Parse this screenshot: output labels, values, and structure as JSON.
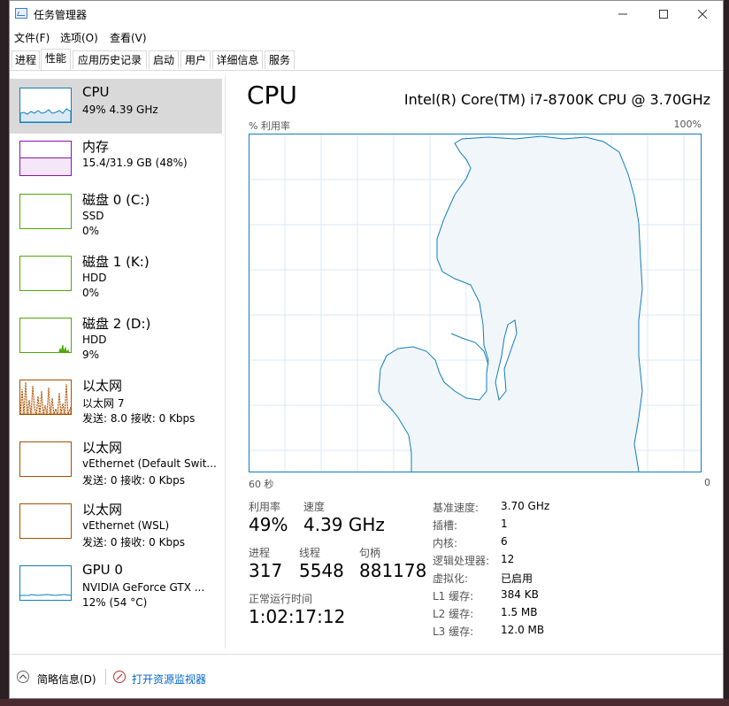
{
  "window": {
    "title": "任务管理器"
  },
  "menu": {
    "file": "文件(F)",
    "options": "选项(O)",
    "view": "查看(V)"
  },
  "tabs": [
    "进程",
    "性能",
    "应用历史记录",
    "启动",
    "用户",
    "详细信息",
    "服务"
  ],
  "sidebar": {
    "items": [
      {
        "title": "CPU",
        "line1": "49% 4.39 GHz",
        "line2": ""
      },
      {
        "title": "内存",
        "line1": "15.4/31.9 GB (48%)",
        "line2": ""
      },
      {
        "title": "磁盘 0 (C:)",
        "line1": "SSD",
        "line2": "0%"
      },
      {
        "title": "磁盘 1 (K:)",
        "line1": "HDD",
        "line2": "0%"
      },
      {
        "title": "磁盘 2 (D:)",
        "line1": "HDD",
        "line2": "9%"
      },
      {
        "title": "以太网",
        "line1": "以太网 7",
        "line2": "发送: 8.0 接收: 0 Kbps"
      },
      {
        "title": "以太网",
        "line1": "vEthernet (Default Swit...",
        "line2": "发送: 0 接收: 0 Kbps"
      },
      {
        "title": "以太网",
        "line1": "vEthernet (WSL)",
        "line2": "发送: 0 接收: 0 Kbps"
      },
      {
        "title": "GPU 0",
        "line1": "NVIDIA GeForce GTX ...",
        "line2": "12% (54 °C)"
      }
    ]
  },
  "main": {
    "title": "CPU",
    "cpu_name": "Intel(R) Core(TM) i7-8700K CPU @ 3.70GHz",
    "graph": {
      "top_left": "% 利用率",
      "top_right": "100%",
      "bottom_left": "60 秒",
      "bottom_right": "0"
    },
    "stats": {
      "util_label": "利用率",
      "util_value": "49%",
      "speed_label": "速度",
      "speed_value": "4.39 GHz",
      "proc_label": "进程",
      "proc_value": "317",
      "threads_label": "线程",
      "threads_value": "5548",
      "handles_label": "句柄",
      "handles_value": "881178",
      "uptime_label": "正常运行时间",
      "uptime_value": "1:02:17:12"
    },
    "specs": [
      {
        "label": "基准速度:",
        "value": "3.70 GHz"
      },
      {
        "label": "插槽:",
        "value": "1"
      },
      {
        "label": "内核:",
        "value": "6"
      },
      {
        "label": "逻辑处理器:",
        "value": "12"
      },
      {
        "label": "虚拟化:",
        "value": "已启用"
      },
      {
        "label": "L1 缓存:",
        "value": "384 KB"
      },
      {
        "label": "L2 缓存:",
        "value": "1.5 MB"
      },
      {
        "label": "L3 缓存:",
        "value": "12.0 MB"
      }
    ]
  },
  "footer": {
    "brief": "简略信息(D)",
    "monitor": "打开资源监视器"
  },
  "colors": {
    "cpu": "#117dbb",
    "memory": "#8b12ae",
    "disk": "#4da60c",
    "ethernet": "#a74f01",
    "gpu": "#117dbb"
  }
}
